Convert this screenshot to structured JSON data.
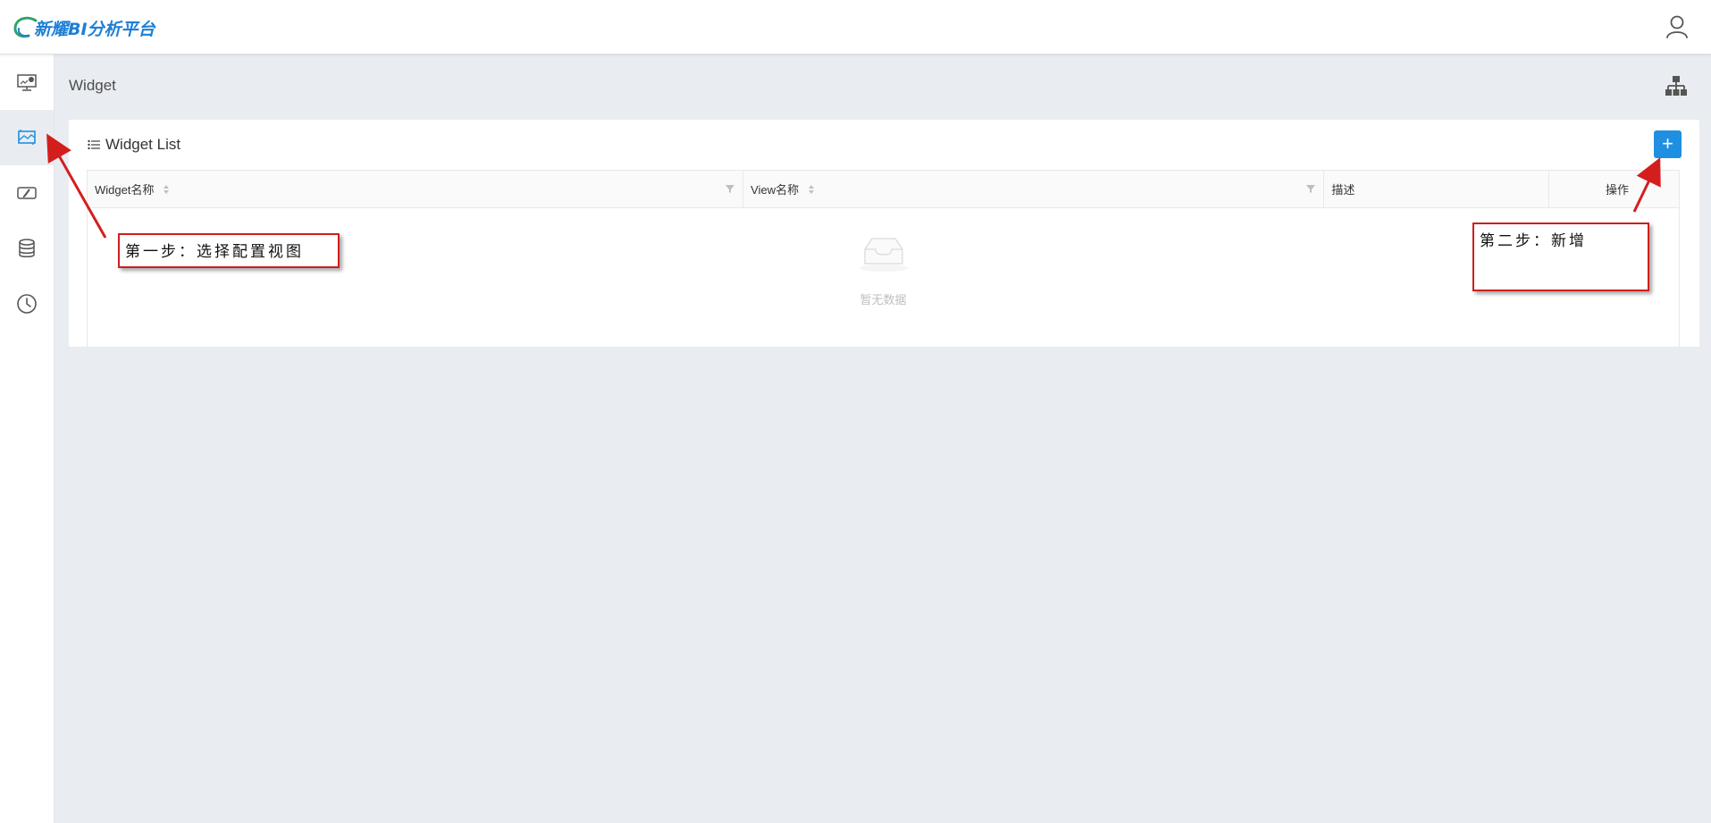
{
  "header": {
    "logo_text": "新耀BI分析平台",
    "user_icon": "user-icon"
  },
  "sidebar": {
    "items": [
      {
        "icon": "dashboard-monitor-icon",
        "active": false
      },
      {
        "icon": "widget-image-icon",
        "active": true
      },
      {
        "icon": "edit-view-icon",
        "active": false
      },
      {
        "icon": "database-icon",
        "active": false
      },
      {
        "icon": "clock-icon",
        "active": false
      }
    ]
  },
  "main": {
    "page_title": "Widget",
    "sitemap_icon": "sitemap-icon",
    "card": {
      "title": "Widget List",
      "add_label": "+",
      "columns": [
        {
          "label": "Widget名称",
          "sortable": true,
          "filterable": true
        },
        {
          "label": "View名称",
          "sortable": true,
          "filterable": true
        },
        {
          "label": "描述",
          "sortable": false,
          "filterable": false
        },
        {
          "label": "操作",
          "sortable": false,
          "filterable": false
        }
      ],
      "rows": [],
      "empty_text": "暂无数据"
    }
  },
  "annotations": {
    "step1": "第一步：选择配置视图",
    "step2": "第二步：新增"
  },
  "colors": {
    "accent": "#1e8fe1",
    "annotation_red": "#cc1f1f",
    "background": "#e9edf2"
  }
}
